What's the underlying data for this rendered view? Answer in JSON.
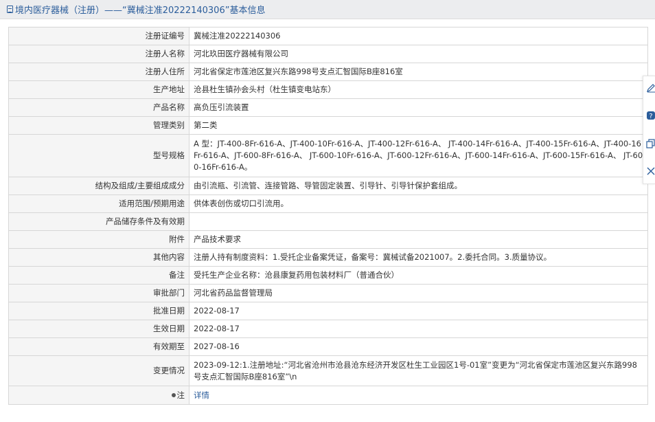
{
  "header": {
    "title": "境内医疗器械（注册）——“冀械注准20222140306”基本信息"
  },
  "rows": [
    {
      "label": "注册证编号",
      "value": "冀械注准20222140306"
    },
    {
      "label": "注册人名称",
      "value": "河北玖田医疗器械有限公司"
    },
    {
      "label": "注册人住所",
      "value": "河北省保定市莲池区复兴东路998号支点汇智国际B座816室"
    },
    {
      "label": "生产地址",
      "value": "沧县杜生镇孙会头村（杜生镇变电站东）"
    },
    {
      "label": "产品名称",
      "value": "高负压引流装置"
    },
    {
      "label": "管理类别",
      "value": "第二类"
    },
    {
      "label": "型号规格",
      "value": "A 型：JT-400-8Fr-616-A、JT-400-10Fr-616-A、JT-400-12Fr-616-A、 JT-400-14Fr-616-A、JT-400-15Fr-616-A、JT-400-16Fr-616-A、JT-600-8Fr-616-A、 JT-600-10Fr-616-A、JT-600-12Fr-616-A、JT-600-14Fr-616-A、JT-600-15Fr-616-A、 JT-600-16Fr-616-A。"
    },
    {
      "label": "结构及组成/主要组成成分",
      "value": "由引流瓶、引流管、连接管路、导管固定装置、引导针、引导针保护套组成。"
    },
    {
      "label": "适用范围/预期用途",
      "value": "供体表创伤或切口引流用。"
    },
    {
      "label": "产品储存条件及有效期",
      "value": ""
    },
    {
      "label": "附件",
      "value": "产品技术要求"
    },
    {
      "label": "其他内容",
      "value": "注册人持有制度资料：1.受托企业备案凭证，备案号：冀械试备2021007。2.委托合同。3.质量协议。"
    },
    {
      "label": "备注",
      "value": "受托生产企业名称：沧县康复药用包装材料厂（普通合伙）"
    },
    {
      "label": "审批部门",
      "value": "河北省药品监督管理局"
    },
    {
      "label": "批准日期",
      "value": "2022-08-17"
    },
    {
      "label": "生效日期",
      "value": "2022-08-17"
    },
    {
      "label": "有效期至",
      "value": "2027-08-16"
    },
    {
      "label": "变更情况",
      "value": "2023-09-12:1.注册地址:“河北省沧州市沧县沧东经济开发区杜生工业园区1号-01室”变更为“河北省保定市莲池区复兴东路998号支点汇智国际B座816室”\\n"
    }
  ],
  "note": {
    "label": "注",
    "link": "详情"
  },
  "side_toolbar": {
    "icons": [
      "edit-icon",
      "help-icon",
      "copy-icon",
      "close-icon"
    ]
  }
}
